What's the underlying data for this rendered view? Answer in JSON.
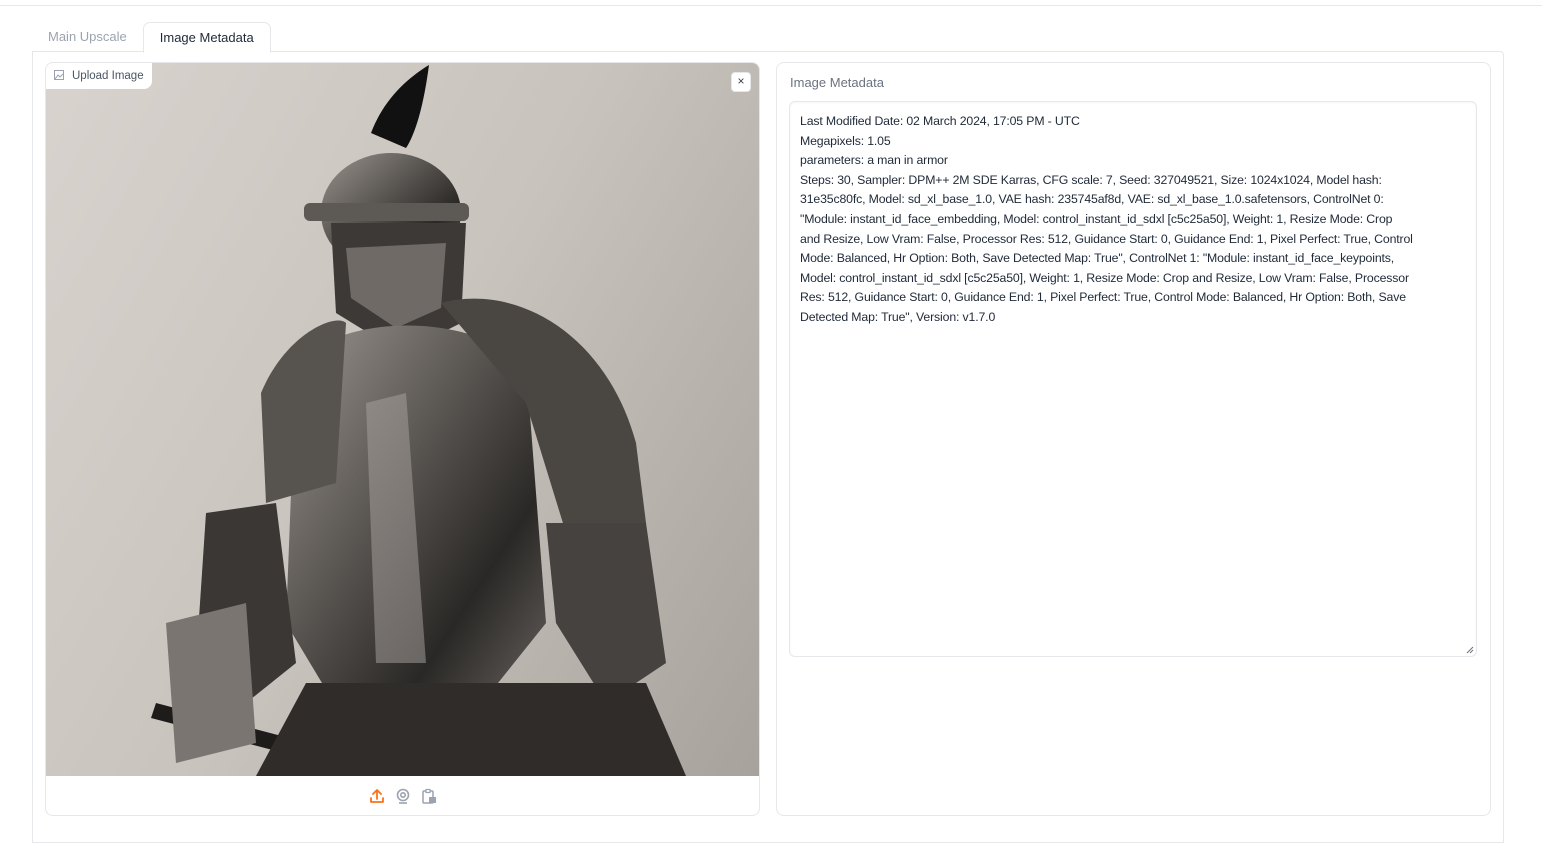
{
  "tabs": [
    {
      "label": "Main Upscale"
    },
    {
      "label": "Image Metadata"
    }
  ],
  "image_panel": {
    "upload_label": "Upload Image",
    "close_label": "×",
    "toolbar": [
      "upload-icon",
      "webcam-icon",
      "clipboard-icon"
    ],
    "accent": "#f97316"
  },
  "metadata_panel": {
    "label": "Image Metadata",
    "lines": [
      "Last Modified Date: 02 March 2024, 17:05 PM - UTC",
      "Megapixels: 1.05",
      "parameters: a man in armor",
      "Steps: 30, Sampler: DPM++ 2M SDE Karras, CFG scale: 7, Seed: 327049521, Size: 1024x1024, Model hash:",
      "31e35c80fc, Model: sd_xl_base_1.0, VAE hash: 235745af8d, VAE: sd_xl_base_1.0.safetensors, ControlNet 0:",
      "\"Module: instant_id_face_embedding, Model: control_instant_id_sdxl [c5c25a50], Weight: 1, Resize Mode: Crop",
      "and Resize, Low Vram: False, Processor Res: 512, Guidance Start: 0, Guidance End: 1, Pixel Perfect: True, Control",
      "Mode: Balanced, Hr Option: Both, Save Detected Map: True\", ControlNet 1: \"Module: instant_id_face_keypoints,",
      "Model: control_instant_id_sdxl [c5c25a50], Weight: 1, Resize Mode: Crop and Resize, Low Vram: False, Processor",
      "Res: 512, Guidance Start: 0, Guidance End: 1, Pixel Perfect: True, Control Mode: Balanced, Hr Option: Both, Save",
      "Detected Map: True\", Version: v1.7.0"
    ]
  }
}
